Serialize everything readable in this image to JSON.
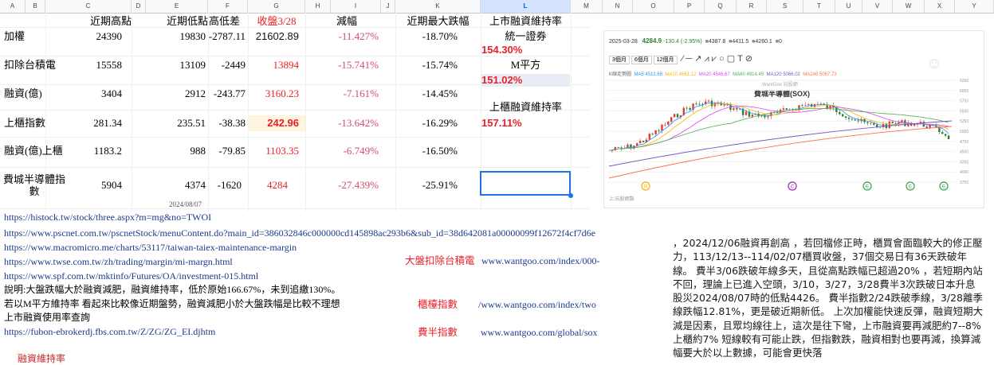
{
  "columns": [
    "A",
    "B",
    "C",
    "D",
    "E",
    "F",
    "G",
    "H",
    "I",
    "J",
    "K",
    "L",
    "M",
    "N",
    "O",
    "P",
    "Q",
    "R",
    "S",
    "T",
    "U",
    "V",
    "W",
    "X",
    "Y"
  ],
  "selected_column": "L",
  "headers": {
    "high": "近期高點",
    "low": "近期低點",
    "diff": "高低差",
    "close": "收盤3/28",
    "drop": "減幅",
    "maxdrop": "近期最大跌幅",
    "margin_ratio": "上市融資維持率"
  },
  "rows": [
    {
      "label": "加權",
      "high": "24390",
      "low": "19830",
      "diff": "-2787.11",
      "close": "21602.89",
      "drop": "-11.427%",
      "maxdrop": "-18.70%"
    },
    {
      "label": "扣除台積電",
      "high": "15558",
      "low": "13109",
      "diff": "-2449",
      "close": "13894",
      "drop": "-15.741%",
      "maxdrop": "-15.74%"
    },
    {
      "label": "融資(億)",
      "high": "3404",
      "low": "2912",
      "diff": "-243.77",
      "close": "3160.23",
      "drop": "-7.161%",
      "maxdrop": "-14.45%"
    },
    {
      "label": "上櫃指數",
      "high": "281.34",
      "low": "235.51",
      "diff": "-38.38",
      "close": "242.96",
      "drop": "-13.642%",
      "maxdrop": "-16.29%"
    },
    {
      "label": "融資(億)上櫃",
      "high": "1183.2",
      "low": "988",
      "diff": "-79.85",
      "close": "1103.35",
      "drop": "-6.749%",
      "maxdrop": "-16.50%"
    },
    {
      "label": "費城半導體指數",
      "high": "5904",
      "low": "4374",
      "diff": "-1620",
      "close": "4284",
      "drop": "-27.439%",
      "maxdrop": "-25.91%"
    }
  ],
  "low_date": "2024/08/07",
  "margin_side": {
    "broker1": "統一證券",
    "broker1_val": "154.30%",
    "broker2": "M平方",
    "broker2_val": "151.02%",
    "otc_label": "上櫃融資維持率",
    "otc_val": "157.11%"
  },
  "links": [
    "https://histock.tw/stock/three.aspx?m=mg&no=TWOI",
    "https://www.pscnet.com.tw/pscnetStock/menuContent.do?main_id=386032846c000000cd145898ac293b6&sub_id=38d642081a00000099f12672f4cf7d6e",
    "https://www.macromicro.me/charts/53117/taiwan-taiex-maintenance-margin",
    "https://www.twse.com.tw/zh/trading/margin/mi-margn.html",
    "https://www.spf.com.tw/mktinfo/Futures/OA/investment-015.html"
  ],
  "explain1": "說明:大盤跌幅大於融資減肥，融資維持率，低於原始166.67%，未到追繳130%。",
  "explain2": "若以M平方維持率 看起來比較像近期盤勢，融資減肥小於大盤跌幅是比較不理想",
  "explain3": "上市融資使用率查詢",
  "link_last": "https://fubon-ebrokerdj.fbs.com.tw/Z/ZG/ZG_EI.djhtm",
  "side_links": [
    {
      "label": "大盤扣除台積電",
      "url": "www.wantgoo.com/index/000-"
    },
    {
      "label": "櫃檯指數",
      "url": "/www.wantgoo.com/index/two"
    },
    {
      "label": "費半指數",
      "url": "www.wantgoo.com/global/sox"
    }
  ],
  "bottom_cut_text": "融資維持率",
  "chart": {
    "date": "2025-03-28",
    "price": "4284.9",
    "change": "-130.4 (-2.95%)",
    "high": "4387.8",
    "low": "4411.5",
    "open": "4260.1",
    "vol": "0",
    "tabs": [
      "3個月",
      "6個月",
      "12個月"
    ],
    "ma_labels": [
      "K線走勢圖",
      "MA5 4512.68",
      "MA10 4561.12",
      "MA20 4546.67",
      "MA60 4914.45",
      "MA120 5066.02",
      "MA240 5067.73"
    ],
    "title": "費城半導體(SOX)",
    "watermark": "WantGoo 玩股網",
    "footer": "上:玩股網製",
    "y_ticks": [
      "6250",
      "6000",
      "5750",
      "5500",
      "5250",
      "5000",
      "4750",
      "4500",
      "4250",
      "4000",
      "3750"
    ],
    "event_labels": [
      "R",
      "C",
      "E",
      "E",
      "E"
    ],
    "colors": {
      "up": "#e53935",
      "down": "#2e7d32",
      "ma5": "#2196f3",
      "ma10": "#ffb300",
      "ma20": "#e040fb",
      "ma60": "#4caf50",
      "ma120": "#7e57c2",
      "ma240": "#ff7043"
    }
  },
  "note_text": "，2024/12/06融資再創高 ，若回檔修正時，櫃買會面臨較大的修正壓力，113/12/13--114/02/07櫃買收盤，37個交易日有36天跌破年線。 費半3/06跌破年線多天，且從高點跌幅已超過20% ，若短期內站不回，理論上已進入空頭，3/10，3/27，3/28費半3次跌破日本升息股災2024/08/07時的低點4426。 費半指數2/24跌破季線，3/28離季線跌幅12.81%，更是破近期新低。 上次加權能快速反彈，融資短期大減是因素，且眾均線往上，這次是往下彎，上市融資要再減肥約7--8% 上櫃約7% 短線較有可能止跌，但指數跌，融資相對也要再減，換算減幅要大於以上數據，可能會更快落"
}
